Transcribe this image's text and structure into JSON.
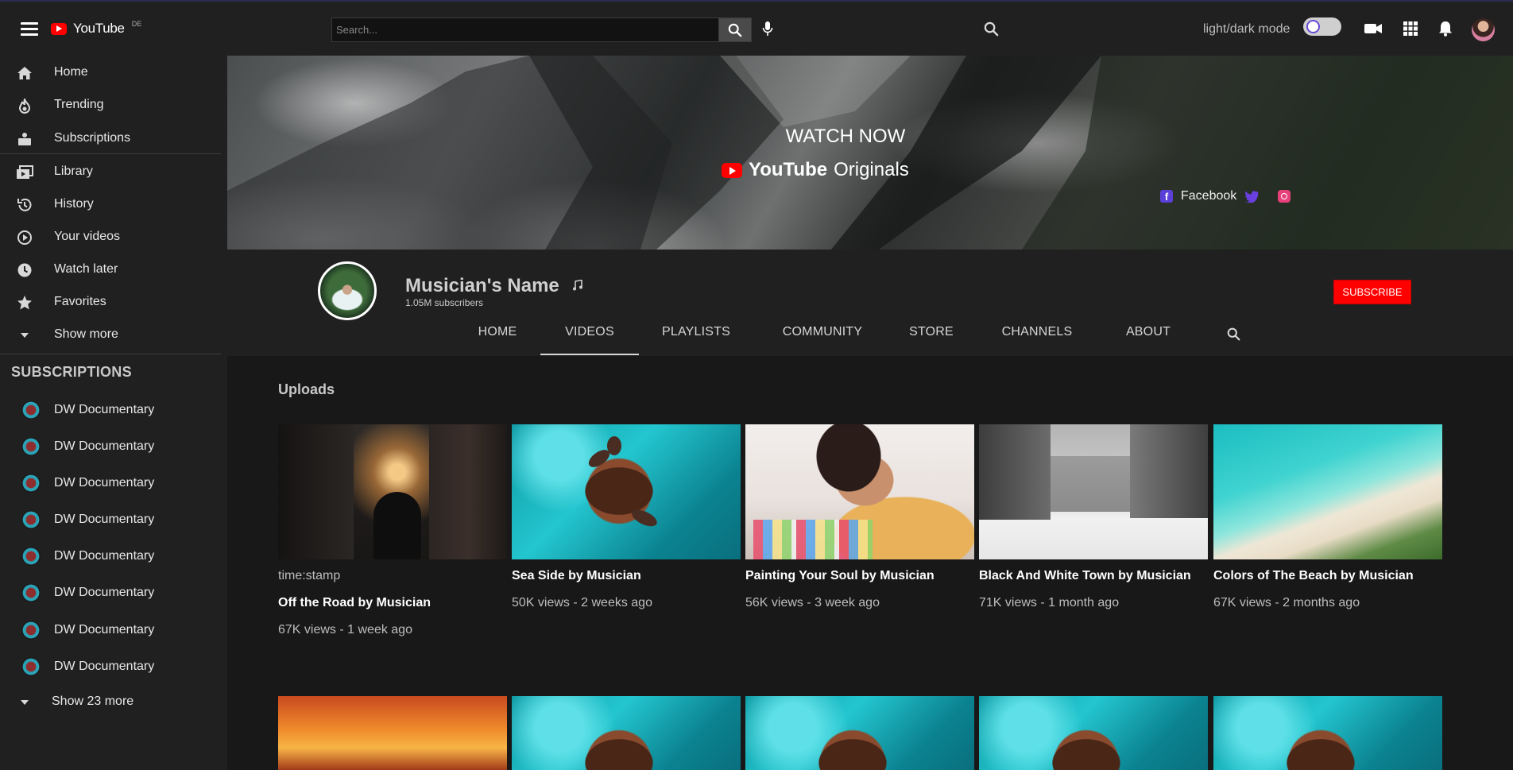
{
  "header": {
    "logo_text": "YouTube",
    "logo_sup": "DE",
    "search_placeholder": "Search...",
    "mode_label": "light/dark mode"
  },
  "sidebar": {
    "main": [
      {
        "label": "Home",
        "icon": "home-icon"
      },
      {
        "label": "Trending",
        "icon": "fire-icon"
      },
      {
        "label": "Subscriptions",
        "icon": "subscriptions-icon"
      }
    ],
    "library": [
      {
        "label": "Library",
        "icon": "library-icon"
      },
      {
        "label": "History",
        "icon": "history-icon"
      },
      {
        "label": "Your videos",
        "icon": "play-circle-icon"
      },
      {
        "label": "Watch later",
        "icon": "clock-icon"
      },
      {
        "label": "Favorites",
        "icon": "star-icon"
      },
      {
        "label": "Show more",
        "icon": "chevron-down-icon"
      }
    ],
    "subs_title": "SUBSCRIPTIONS",
    "subscriptions": [
      "DW Documentary",
      "DW Documentary",
      "DW Documentary",
      "DW Documentary",
      "DW Documentary",
      "DW Documentary",
      "DW Documentary",
      "DW Documentary"
    ],
    "show_more_subs": "Show 23 more"
  },
  "banner": {
    "watch_now": "WATCH NOW",
    "brand_bold": "YouTube",
    "brand_rest": "Originals",
    "facebook": "Facebook"
  },
  "channel": {
    "name": "Musician's Name",
    "subscribers": "1.05M subscribers",
    "subscribe_label": "SUBSCRIBE",
    "tabs": [
      "HOME",
      "VIDEOS",
      "PLAYLISTS",
      "COMMUNITY",
      "STORE",
      "CHANNELS",
      "ABOUT"
    ],
    "active_tab": "VIDEOS"
  },
  "uploads": {
    "title": "Uploads",
    "videos": [
      {
        "stamp": "time:stamp",
        "title": "Off the Road by Musician",
        "meta": "67K views - 1 week ago"
      },
      {
        "title": "Sea Side by Musician",
        "meta": "50K views - 2 weeks ago"
      },
      {
        "title": "Painting Your Soul by Musician",
        "meta": "56K views - 3 week ago"
      },
      {
        "title": "Black And White Town by Musician",
        "meta": "71K views - 1 month ago"
      },
      {
        "title": "Colors of The Beach by Musician",
        "meta": "67K views - 2 months ago"
      }
    ]
  },
  "colors": {
    "accent": "#ff0000",
    "sidebar_bg": "#202020",
    "page_bg": "#181818",
    "social_purple": "#5b3fd9"
  }
}
